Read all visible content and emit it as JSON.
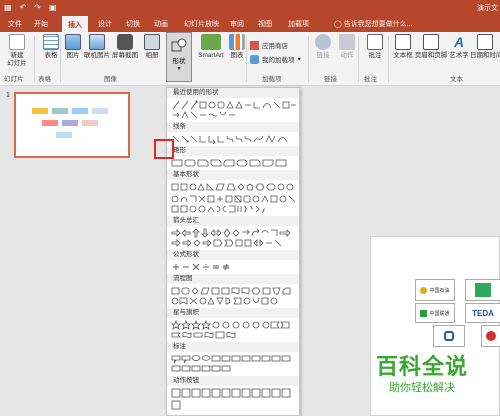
{
  "titlebar": {
    "save_icon": "save-icon",
    "undo_icon": "undo-icon",
    "redo_icon": "redo-icon",
    "start_icon": "slideshow-start-icon",
    "window_title": "演示文"
  },
  "tabs": [
    "文件",
    "开始",
    "插入",
    "设计",
    "切换",
    "动画",
    "幻灯片放映",
    "审阅",
    "视图",
    "加载项"
  ],
  "active_tab": "插入",
  "tell_me": "告诉我您想要做什么...",
  "ribbon": {
    "new_slide": "新建\n幻灯片",
    "table": "表格",
    "image": "图片",
    "online_image": "联机图片",
    "screenshot": "屏幕截图",
    "album": "相册",
    "shapes": "形状",
    "smartart": "SmartArt",
    "chart": "图表",
    "app_store": "应用商店",
    "my_addins": "我的加载项",
    "link": "链接",
    "action": "动作",
    "comment": "批注",
    "textbox": "文本框",
    "header_footer": "页眉和页脚",
    "wordart": "艺术字",
    "datetime": "日期和时间",
    "groups": {
      "slides": "幻灯片",
      "tables": "表格",
      "images": "图像",
      "addins": "加载项",
      "links": "链接",
      "comments": "批注",
      "text": "文本"
    }
  },
  "thumb": {
    "slide_number": "1"
  },
  "shapes_menu": {
    "categories": [
      "最近使用的形状",
      "线条",
      "矩形",
      "基本形状",
      "箭头总汇",
      "公式形状",
      "流程图",
      "星与旗帜",
      "标注",
      "动作按钮"
    ]
  },
  "slide_logos": [
    "中国石油",
    "中国移动",
    "中国联通",
    "TEDA",
    "中国电信"
  ],
  "watermark": {
    "main": "百科全说",
    "sub": "助你轻松解决"
  },
  "colors": {
    "accent": "#b7472a",
    "highlight": "#e0262a"
  }
}
